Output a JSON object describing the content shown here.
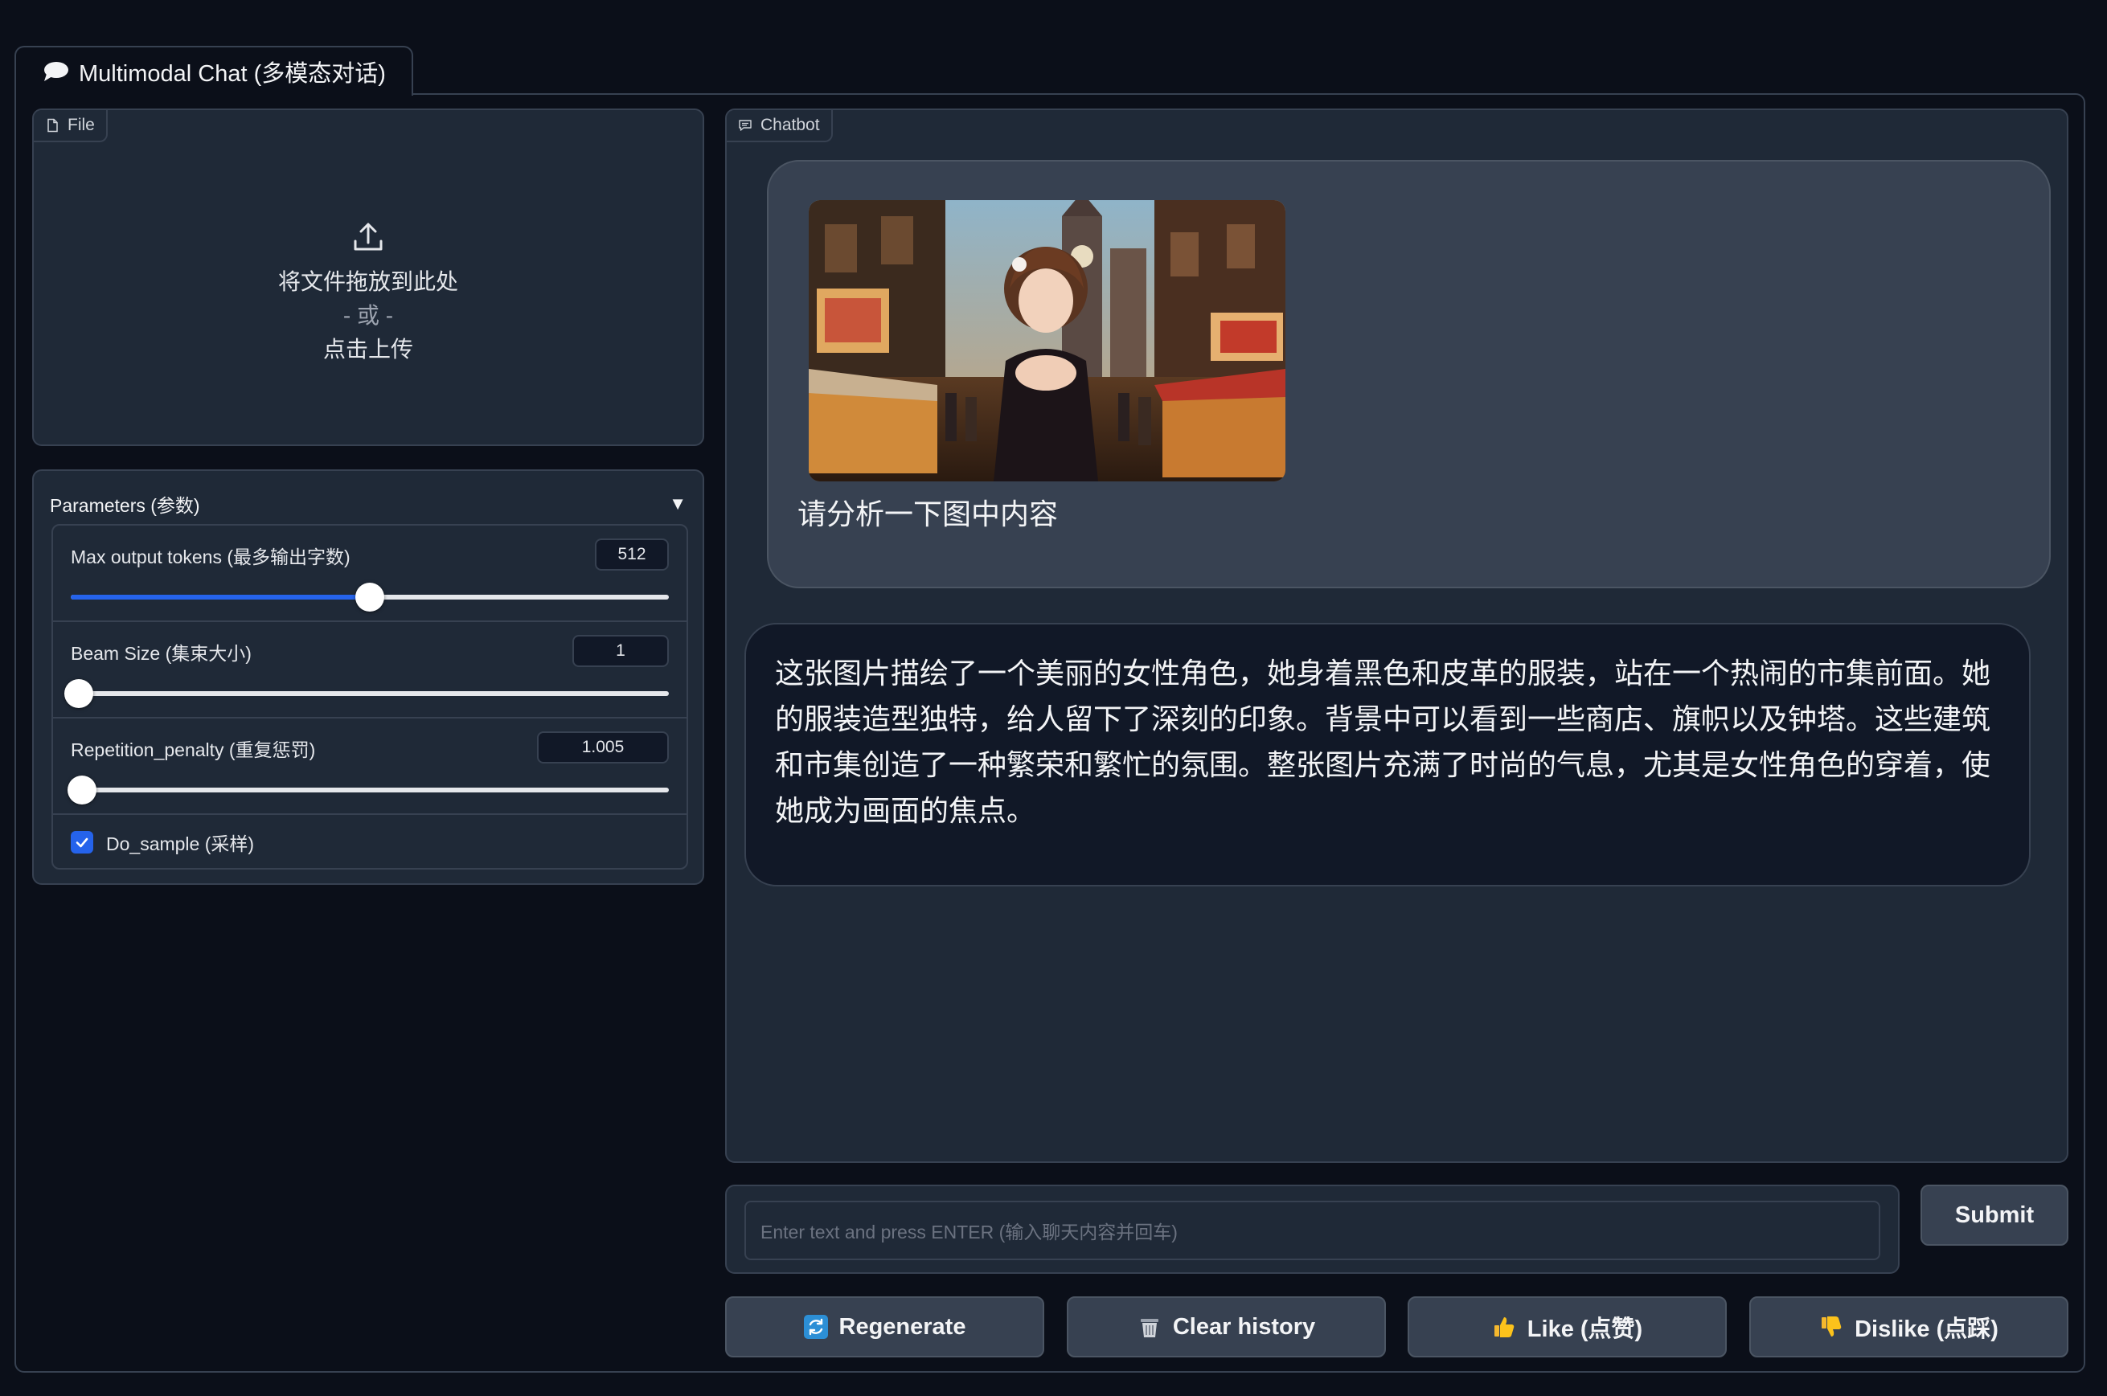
{
  "tab": {
    "label": "Multimodal Chat (多模态对话)",
    "icon": "speech-bubble-icon"
  },
  "file": {
    "label": "File",
    "drop_text": "将文件拖放到此处",
    "or_text": "- 或 -",
    "click_text": "点击上传"
  },
  "params": {
    "title": "Parameters (参数)",
    "max_tokens": {
      "label": "Max output tokens (最多输出字数)",
      "value": "512",
      "level": 0.5
    },
    "beam_size": {
      "label": "Beam Size (集束大小)",
      "value": "1",
      "level": 0.0
    },
    "repetition_penalty": {
      "label": "Repetition_penalty (重复惩罚)",
      "value": "1.005",
      "level": 0.005
    },
    "do_sample": {
      "label": "Do_sample (采样)",
      "checked": true
    }
  },
  "chatbot": {
    "label": "Chatbot",
    "user_message": "请分析一下图中内容",
    "bot_message": "这张图片描绘了一个美丽的女性角色，她身着黑色和皮革的服装，站在一个热闹的市集前面。她的服装造型独特，给人留下了深刻的印象。背景中可以看到一些商店、旗帜以及钟塔。这些建筑和市集创造了一种繁荣和繁忙的氛围。整张图片充满了时尚的气息，尤其是女性角色的穿着，使她成为画面的焦点。"
  },
  "input": {
    "placeholder": "Enter text and press ENTER (输入聊天内容并回车)",
    "value": ""
  },
  "buttons": {
    "submit": "Submit",
    "regenerate": "Regenerate",
    "clear": "Clear history",
    "like": "Like (点赞)",
    "dislike": "Dislike (点踩)"
  },
  "colors": {
    "background": "#0b0f19",
    "panel": "#1f2937",
    "border": "#374151",
    "accent": "#2563eb"
  }
}
